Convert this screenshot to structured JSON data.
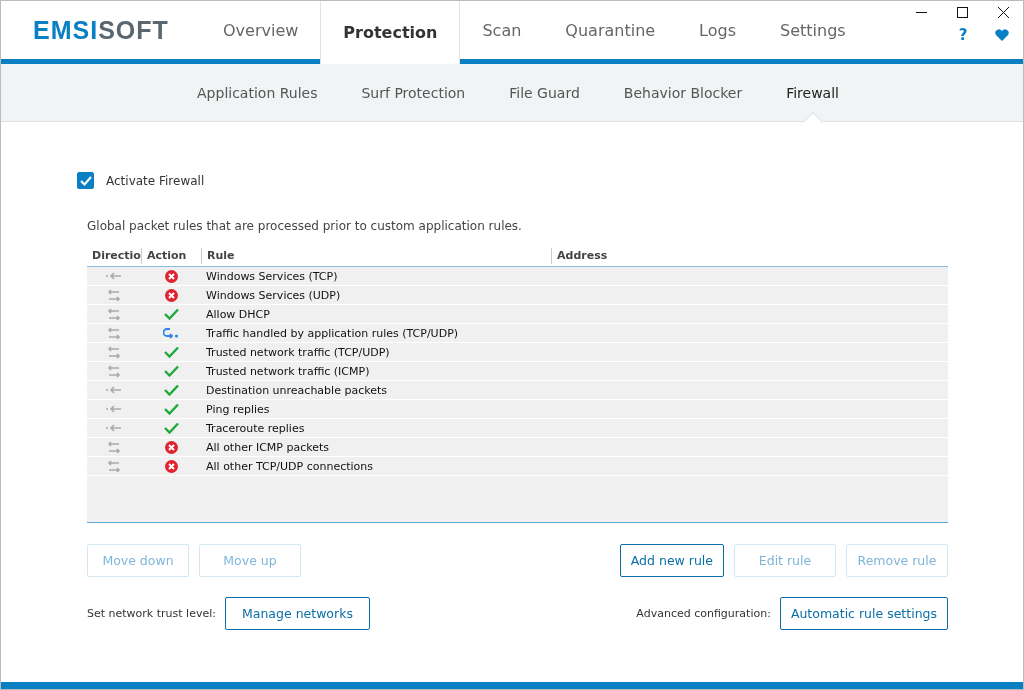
{
  "logo": {
    "part1": "EMSI",
    "part2": "SOFT"
  },
  "tabs": [
    {
      "label": "Overview",
      "selected": false
    },
    {
      "label": "Protection",
      "selected": true
    },
    {
      "label": "Scan",
      "selected": false
    },
    {
      "label": "Quarantine",
      "selected": false
    },
    {
      "label": "Logs",
      "selected": false
    },
    {
      "label": "Settings",
      "selected": false
    }
  ],
  "help": "?",
  "subtabs": [
    {
      "label": "Application Rules",
      "selected": false
    },
    {
      "label": "Surf Protection",
      "selected": false
    },
    {
      "label": "File Guard",
      "selected": false
    },
    {
      "label": "Behavior Blocker",
      "selected": false
    },
    {
      "label": "Firewall",
      "selected": true
    }
  ],
  "activate": {
    "label": "Activate Firewall",
    "checked": true
  },
  "description": "Global packet rules that are processed prior to custom application rules.",
  "table": {
    "columns": [
      "Directio",
      "Action",
      "Rule",
      "Address"
    ],
    "rows": [
      {
        "direction": {
          "kind": "in"
        },
        "action": {
          "kind": "block"
        },
        "rule": "Windows Services (TCP)"
      },
      {
        "direction": {
          "kind": "both"
        },
        "action": {
          "kind": "block"
        },
        "rule": "Windows Services (UDP)"
      },
      {
        "direction": {
          "kind": "both"
        },
        "action": {
          "kind": "allow"
        },
        "rule": "Allow DHCP"
      },
      {
        "direction": {
          "kind": "both"
        },
        "action": {
          "kind": "app"
        },
        "rule": "Traffic handled by application rules (TCP/UDP)"
      },
      {
        "direction": {
          "kind": "both"
        },
        "action": {
          "kind": "allow"
        },
        "rule": "Trusted network traffic (TCP/UDP)"
      },
      {
        "direction": {
          "kind": "both"
        },
        "action": {
          "kind": "allow"
        },
        "rule": "Trusted network traffic (ICMP)"
      },
      {
        "direction": {
          "kind": "in"
        },
        "action": {
          "kind": "allow"
        },
        "rule": "Destination unreachable packets"
      },
      {
        "direction": {
          "kind": "in"
        },
        "action": {
          "kind": "allow"
        },
        "rule": "Ping replies"
      },
      {
        "direction": {
          "kind": "in"
        },
        "action": {
          "kind": "allow"
        },
        "rule": "Traceroute replies"
      },
      {
        "direction": {
          "kind": "both"
        },
        "action": {
          "kind": "block"
        },
        "rule": "All other ICMP packets"
      },
      {
        "direction": {
          "kind": "both"
        },
        "action": {
          "kind": "block"
        },
        "rule": "All other TCP/UDP connections"
      }
    ]
  },
  "left_buttons": [
    {
      "label": "Move down",
      "disabled": true
    },
    {
      "label": "Move up",
      "disabled": true
    }
  ],
  "right_buttons": [
    {
      "label": "Add new rule",
      "disabled": false
    },
    {
      "label": "Edit rule",
      "disabled": true
    },
    {
      "label": "Remove rule",
      "disabled": true
    }
  ],
  "trust": {
    "label": "Set network trust level:",
    "button": "Manage networks"
  },
  "advanced": {
    "label": "Advanced configuration:",
    "button": "Automatic rule settings"
  }
}
